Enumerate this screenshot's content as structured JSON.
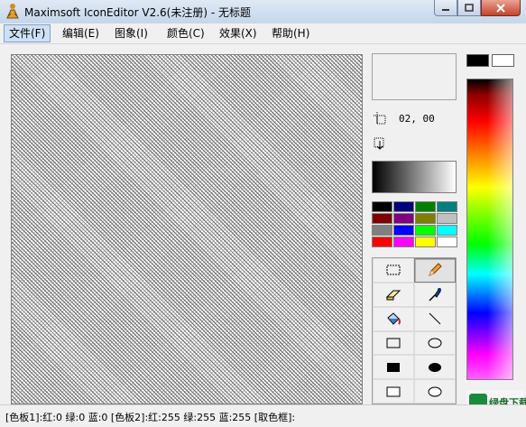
{
  "window": {
    "title": "Maximsoft IconEditor V2.6(未注册) - 无标题",
    "icon": "app-icon"
  },
  "menu": [
    {
      "label": "文件(F)",
      "active": true
    },
    {
      "label": "编辑(E)"
    },
    {
      "label": "图象(I)"
    },
    {
      "label": "颜色(C)"
    },
    {
      "label": "效果(X)"
    },
    {
      "label": "帮助(H)"
    }
  ],
  "panel": {
    "coord": "02, 00",
    "palette": [
      "#000000",
      "#000080",
      "#008000",
      "#008080",
      "#800000",
      "#800080",
      "#808000",
      "#c0c0c0",
      "#808080",
      "#0000ff",
      "#00ff00",
      "#00ffff",
      "#ff0000",
      "#ff00ff",
      "#ffff00",
      "#ffffff"
    ]
  },
  "tools": [
    {
      "name": "rect-select-tool",
      "icon": "dashed-rect-icon"
    },
    {
      "name": "pencil-tool",
      "icon": "pencil-icon",
      "selected": true
    },
    {
      "name": "eraser-tool",
      "icon": "eraser-icon"
    },
    {
      "name": "color-picker-tool",
      "icon": "dropper-icon"
    },
    {
      "name": "fill-tool",
      "icon": "bucket-icon"
    },
    {
      "name": "line-tool",
      "icon": "line-icon"
    },
    {
      "name": "rect-tool",
      "icon": "rect-outline-icon"
    },
    {
      "name": "ellipse-tool",
      "icon": "ellipse-outline-icon"
    },
    {
      "name": "filled-rect-tool",
      "icon": "rect-filled-icon"
    },
    {
      "name": "filled-ellipse-tool",
      "icon": "ellipse-filled-icon"
    },
    {
      "name": "framed-rect-tool",
      "icon": "rect-framed-icon"
    },
    {
      "name": "framed-ellipse-tool",
      "icon": "ellipse-framed-icon"
    }
  ],
  "colors": {
    "foreground": "#000000",
    "background": "#ffffff"
  },
  "watermark": "绿盘下载",
  "status": "[色板1]:红:0 绿:0 蓝:0  [色板2]:红:255 绿:255 蓝:255  [取色框]:"
}
